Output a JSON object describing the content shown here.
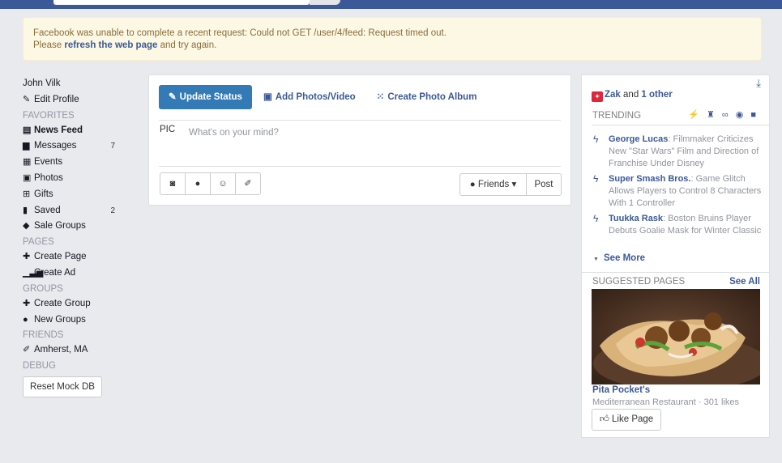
{
  "alert": {
    "line1": "Facebook was unable to complete a recent request: Could not GET /user/4/feed: Request timed out.",
    "line2_prefix": "Please ",
    "line2_link": "refresh the web page",
    "line2_suffix": " and try again."
  },
  "leftnav": {
    "user_name": "John Vilk",
    "edit_profile": "Edit Profile",
    "favorites_header": "FAVORITES",
    "news_feed": "News Feed",
    "messages": "Messages",
    "messages_count": "7",
    "events": "Events",
    "photos": "Photos",
    "gifts": "Gifts",
    "saved": "Saved",
    "saved_count": "2",
    "sale_groups": "Sale Groups",
    "pages_header": "PAGES",
    "create_page": "Create Page",
    "create_ad": "Create Ad",
    "groups_header": "GROUPS",
    "create_group": "Create Group",
    "new_groups": "New Groups",
    "friends_header": "FRIENDS",
    "location": "Amherst, MA",
    "debug_header": "DEBUG",
    "reset_button": "Reset Mock DB"
  },
  "composer": {
    "tab_update": "Update Status",
    "tab_photos": "Add Photos/Video",
    "tab_album": "Create Photo Album",
    "pic_label": "PIC",
    "placeholder": "What's on your mind?",
    "audience": "Friends",
    "post": "Post"
  },
  "rightcol": {
    "birthday_name": "Zak",
    "birthday_and": " and ",
    "birthday_other": "1 other",
    "trending_label": "TRENDING",
    "trending": [
      {
        "topic": "George Lucas",
        "desc": ": Filmmaker Criticizes New \"Star Wars\" Film and Direction of Franchise Under Disney"
      },
      {
        "topic": "Super Smash Bros.",
        "desc": ": Game Glitch Allows Players to Control 8 Characters With 1 Controller"
      },
      {
        "topic": "Tuukka Rask",
        "desc": ": Boston Bruins Player Debuts Goalie Mask for Winter Classic"
      }
    ],
    "see_more": "See More",
    "suggested_label": "SUGGESTED PAGES",
    "see_all": "See All",
    "page_name": "Pita Pocket's",
    "page_meta": "Mediterranean Restaurant · 301 likes",
    "like_button": "Like Page"
  }
}
